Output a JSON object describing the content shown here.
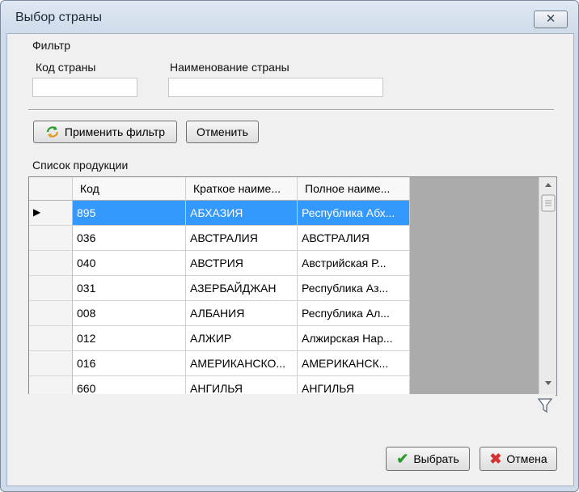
{
  "window": {
    "title": "Выбор страны",
    "close_glyph": "✕"
  },
  "filter": {
    "group_label": "Фильтр",
    "code_label": "Код страны",
    "code_value": "",
    "name_label": "Наименование страны",
    "name_value": "",
    "apply_label": "Применить фильтр",
    "cancel_label": "Отменить"
  },
  "grid": {
    "label": "Список продукции",
    "columns": [
      "Код",
      "Краткое наиме...",
      "Полное наиме..."
    ],
    "rows": [
      [
        "895",
        "АБХАЗИЯ",
        "Республика Абх..."
      ],
      [
        "036",
        "АВСТРАЛИЯ",
        "АВСТРАЛИЯ"
      ],
      [
        "040",
        "АВСТРИЯ",
        "Австрийская Р..."
      ],
      [
        "031",
        "АЗЕРБАЙДЖАН",
        "Республика Аз..."
      ],
      [
        "008",
        "АЛБАНИЯ",
        "Республика Ал..."
      ],
      [
        "012",
        "АЛЖИР",
        "Алжирская Нар..."
      ],
      [
        "016",
        "АМЕРИКАНСКО...",
        "АМЕРИКАНСК..."
      ],
      [
        "660",
        "АНГИЛЬЯ",
        "АНГИЛЬЯ"
      ]
    ],
    "selected_row": 0,
    "current_row_marker": "▶"
  },
  "buttons": {
    "ok_label": "Выбрать",
    "cancel_label": "Отмена"
  },
  "colors": {
    "selection": "#3399ff",
    "ok_check": "#2e9a2e",
    "cancel_x": "#d83030"
  }
}
